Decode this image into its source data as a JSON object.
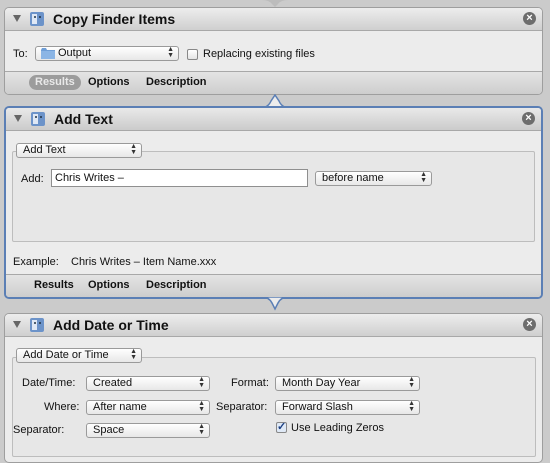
{
  "copy_finder": {
    "title": "Copy Finder Items",
    "to_label": "To:",
    "destination": "Output",
    "replace_label": "Replacing existing files",
    "tabs": [
      "Results",
      "Options",
      "Description"
    ]
  },
  "add_text": {
    "title": "Add Text",
    "mode": "Add Text",
    "add_label": "Add:",
    "text_value": "Chris Writes – ",
    "position": "before name",
    "example_label": "Example:",
    "example_value": "Chris Writes – Item Name.xxx",
    "tabs": [
      "Results",
      "Options",
      "Description"
    ]
  },
  "add_date": {
    "title": "Add Date or Time",
    "mode": "Add Date or Time",
    "datetime_label": "Date/Time:",
    "datetime_value": "Created",
    "where_label": "Where:",
    "where_value": "After name",
    "separator_label": "Separator:",
    "separator_value": "Space",
    "format_label": "Format:",
    "format_value": "Month Day Year",
    "separator2_label": "Separator:",
    "separator2_value": "Forward Slash",
    "leading_zeros_label": "Use Leading Zeros",
    "leading_zeros_checked": true
  },
  "icons": [
    "disclosure-triangle-icon",
    "automator-robot-icon",
    "close-icon",
    "folder-icon",
    "popup-arrows-icon",
    "checkmark-icon"
  ]
}
